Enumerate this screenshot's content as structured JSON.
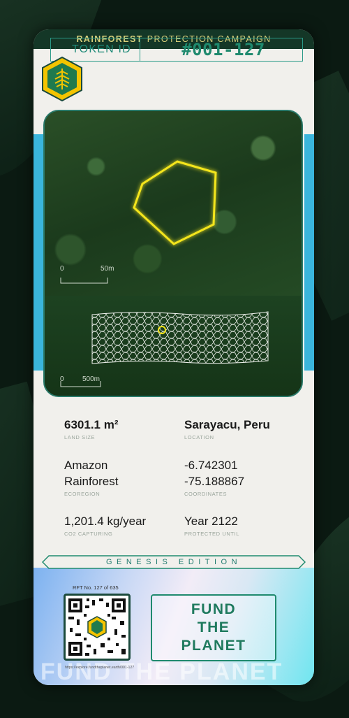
{
  "banner": {
    "bold": "RAINFOREST",
    "rest": "PROTECTION CAMPAIGN"
  },
  "token": {
    "label": "TOKEN ID",
    "value": "#001-127"
  },
  "map": {
    "scale_top_zero": "0",
    "scale_top_dist": "50m",
    "scale_bottom_zero": "0",
    "scale_bottom_dist": "500m"
  },
  "stats": {
    "land_size": {
      "value": "6301.1 m²",
      "label": "LAND SIZE"
    },
    "location": {
      "value": "Sarayacu, Peru",
      "label": "LOCATION"
    },
    "ecoregion": {
      "value_line1": "Amazon",
      "value_line2": "Rainforest",
      "label": "ECOREGION"
    },
    "coordinates": {
      "value_line1": "-6.742301",
      "value_line2": "-75.188867",
      "label": "COORDINATES"
    },
    "co2": {
      "value": "1,201.4 kg/year",
      "label": "CO2 CAPTURING"
    },
    "protected": {
      "value": "Year 2122",
      "label": "PROTECTED UNTIL"
    }
  },
  "edition": "GENESIS EDITION",
  "rft": "RFT No. 127 of 635",
  "qr_url": "https://explore.fundtheplanet.earth/001-127",
  "fund_button": "FUND\nTHE\nPLANET",
  "watermark": "FUND THE PLANET",
  "colors": {
    "accent": "#1f8a6e",
    "banner": "#143727",
    "gold": "#f4c400",
    "cyan": "#3ab5dc"
  }
}
